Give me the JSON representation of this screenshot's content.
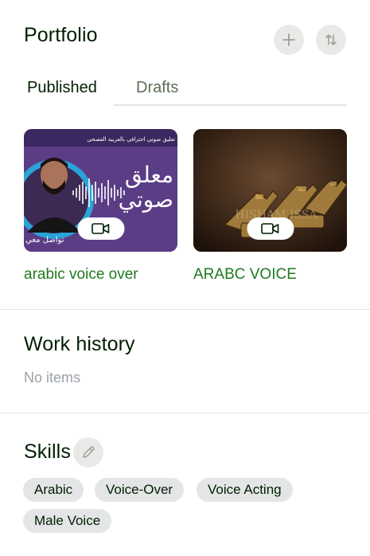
{
  "portfolio": {
    "title": "Portfolio",
    "add_icon": "plus-icon",
    "sort_icon": "sort-arrows-icon",
    "tabs": [
      {
        "label": "Published",
        "active": true
      },
      {
        "label": "Drafts",
        "active": false
      }
    ],
    "items": [
      {
        "title": "arabic voice over",
        "media_icon": "video-camera-icon",
        "thumb_text": [
          "معلق",
          "صوتي",
          "تعليق صوتي احترافي بالعربية الفصحى",
          "تواصل معي"
        ]
      },
      {
        "title": "ARABC VOICE",
        "media_icon": "video-camera-icon",
        "thumb_text": [
          "HISHAM ISSA"
        ]
      }
    ]
  },
  "work_history": {
    "title": "Work history",
    "empty_text": "No items"
  },
  "skills": {
    "title": "Skills",
    "edit_icon": "pencil-icon",
    "chips": [
      "Arabic",
      "Voice-Over",
      "Voice Acting",
      "Male Voice"
    ]
  },
  "colors": {
    "link_green": "#1f7a1f",
    "chip_bg": "#e4e5e7",
    "button_bg": "#e9eae8",
    "muted_text": "#9aa0a6"
  }
}
